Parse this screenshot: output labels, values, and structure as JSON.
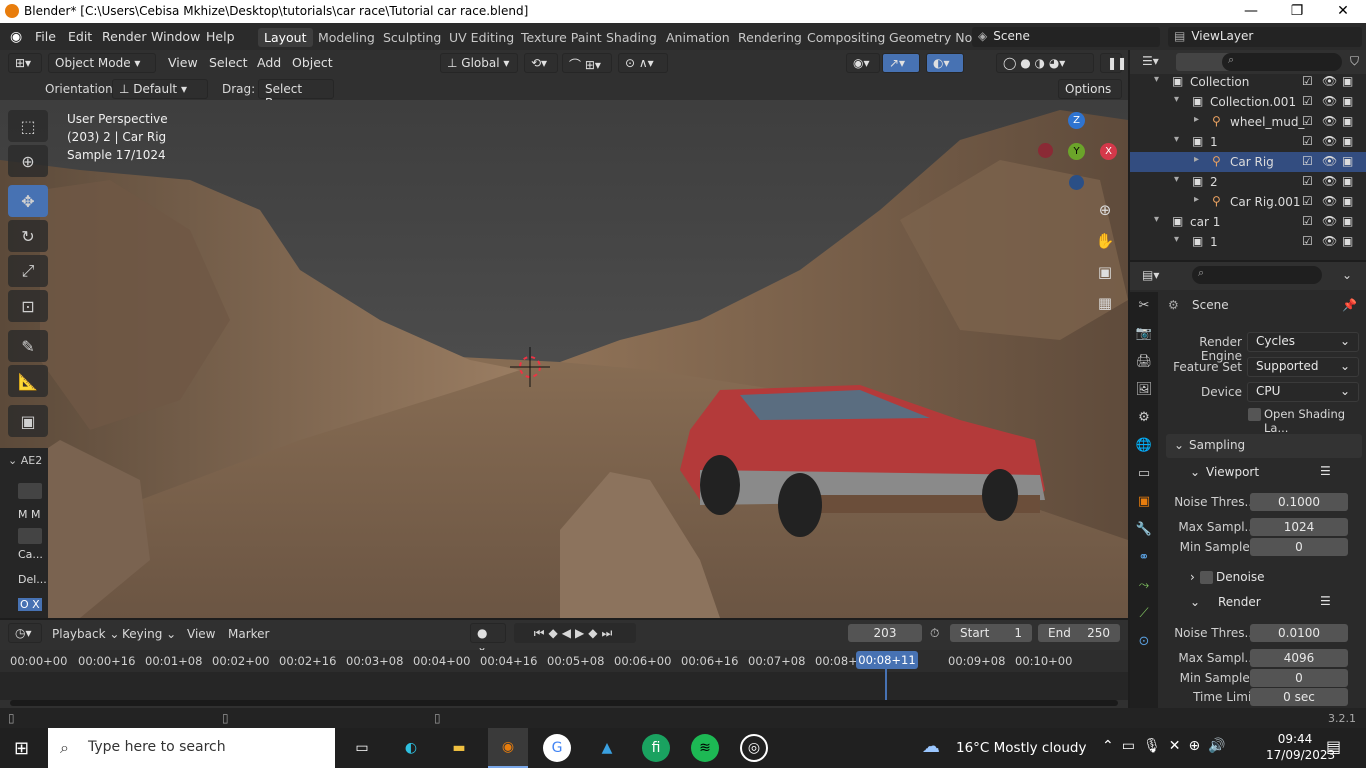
{
  "titlebar": {
    "title": "Blender* [C:\\Users\\Cebisa Mkhize\\Desktop\\tutorials\\car race\\Tutorial car race.blend]",
    "min": "—",
    "max": "❐",
    "close": "✕"
  },
  "menu": {
    "file": "File",
    "edit": "Edit",
    "render": "Render",
    "window": "Window",
    "help": "Help"
  },
  "workspaces": [
    "Layout",
    "Modeling",
    "Sculpting",
    "UV Editing",
    "Texture Paint",
    "Shading",
    "Animation",
    "Rendering",
    "Compositing",
    "Geometry Noc"
  ],
  "scene_name": "Scene",
  "viewlayer_name": "ViewLayer",
  "viewport_header": {
    "mode": "Object Mode",
    "view": "View",
    "select": "Select",
    "add": "Add",
    "object": "Object",
    "transform": "Global"
  },
  "tool_settings": {
    "orientation_label": "Orientation:",
    "orientation": "Default",
    "drag_label": "Drag:",
    "drag": "Select Box",
    "options": "Options"
  },
  "viewport_info": {
    "line1": "User Perspective",
    "line2": "(203) 2 | Car Rig",
    "line3": "Sample 17/1024"
  },
  "gizmo": {
    "x": "X",
    "y": "Y",
    "z": "Z"
  },
  "sidebar_tab": {
    "label": "AE2",
    "mm": "M M",
    "ca": "Ca...",
    "del": "Del...",
    "ox": "O X"
  },
  "outliner": [
    {
      "label": "Collection",
      "indent": 0
    },
    {
      "label": "Collection.001",
      "indent": 1
    },
    {
      "label": "wheel_mud_",
      "indent": 2
    },
    {
      "label": "1",
      "indent": 1
    },
    {
      "label": "Car Rig",
      "indent": 2,
      "selected": true
    },
    {
      "label": "2",
      "indent": 1
    },
    {
      "label": "Car Rig.001",
      "indent": 2
    },
    {
      "label": "car 1",
      "indent": 0
    },
    {
      "label": "1",
      "indent": 1
    }
  ],
  "props": {
    "context": "Scene",
    "render_engine_label": "Render Engine",
    "render_engine": "Cycles",
    "feature_set_label": "Feature Set",
    "feature_set": "Supported",
    "device_label": "Device",
    "device": "CPU",
    "osl_label": "Open Shading La...",
    "sampling": "Sampling",
    "viewport": "Viewport",
    "noise_label": "Noise Thres...",
    "vp_noise": "0.1000",
    "max_label": "Max Sampl...",
    "vp_max": "1024",
    "min_label": "Min Samples",
    "vp_min": "0",
    "denoise": "Denoise",
    "render": "Render",
    "r_noise": "0.0100",
    "r_max": "4096",
    "r_min": "0",
    "time_label": "Time Limit",
    "time_limit": "0 sec"
  },
  "timeline": {
    "playback": "Playback",
    "keying": "Keying",
    "view": "View",
    "marker": "Marker",
    "frame": "203",
    "start_label": "Start",
    "start": "1",
    "end_label": "End",
    "end": "250",
    "labels": [
      "00:00+00",
      "00:00+16",
      "00:01+08",
      "00:02+00",
      "00:02+16",
      "00:03+08",
      "00:04+00",
      "00:04+16",
      "00:05+08",
      "00:06+00",
      "00:06+16",
      "00:07+08",
      "00:08+",
      "16",
      "00:09+08",
      "00:10+00"
    ],
    "current": "00:08+11"
  },
  "version": "3.2.1",
  "taskbar": {
    "search": "Type here to search",
    "weather": "16°C  Mostly cloudy",
    "time": "09:44",
    "date": "17/09/2023"
  }
}
